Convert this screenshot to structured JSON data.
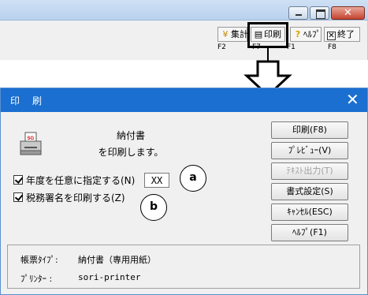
{
  "top_window": {
    "close_glyph": "✕",
    "toolbar": {
      "shukei_label": "集計",
      "insatsu_label": "印刷",
      "help_label": "ﾍﾙﾌﾟ",
      "exit_label": "終了"
    },
    "function_keys": {
      "shukei": "F2",
      "insatsu": "F7",
      "help": "F1",
      "exit": "F8"
    }
  },
  "dialog": {
    "title": "印刷",
    "doc_name": "納付書",
    "message": "を印刷します。",
    "options": {
      "year_label": "年度を任意に指定する(N)",
      "year_checked": true,
      "year_value": "XX",
      "zeimu_label": "税務署名を印刷する(Z)",
      "zeimu_checked": true
    },
    "callouts": {
      "a": "a",
      "b": "b"
    },
    "buttons": {
      "print": "印刷(F8)",
      "preview": "ﾌﾟﾚﾋﾞｭｰ(V)",
      "text_out": "ﾃｷｽﾄ出力(T)",
      "format": "書式設定(S)",
      "cancel": "ｷｬﾝｾﾙ(ESC)",
      "help": "ﾍﾙﾌﾟ(F1)"
    },
    "info": {
      "type_label": "帳票ﾀｲﾌﾟ:",
      "type_value": "納付書（専用用紙）",
      "printer_label": "ﾌﾟﾘﾝﾀｰ  :",
      "printer_value": "sori-printer"
    }
  },
  "colors": {
    "dialog_titlebar": "#1a6fd0",
    "window_bg": "#f0f0f0",
    "highlight_border": "#000000",
    "disabled_text": "#a0a0a0"
  },
  "icons": [
    "window-close-icon",
    "minimize-icon",
    "maximize-icon",
    "printer-icon",
    "down-arrow-icon",
    "checkmark-icon"
  ]
}
